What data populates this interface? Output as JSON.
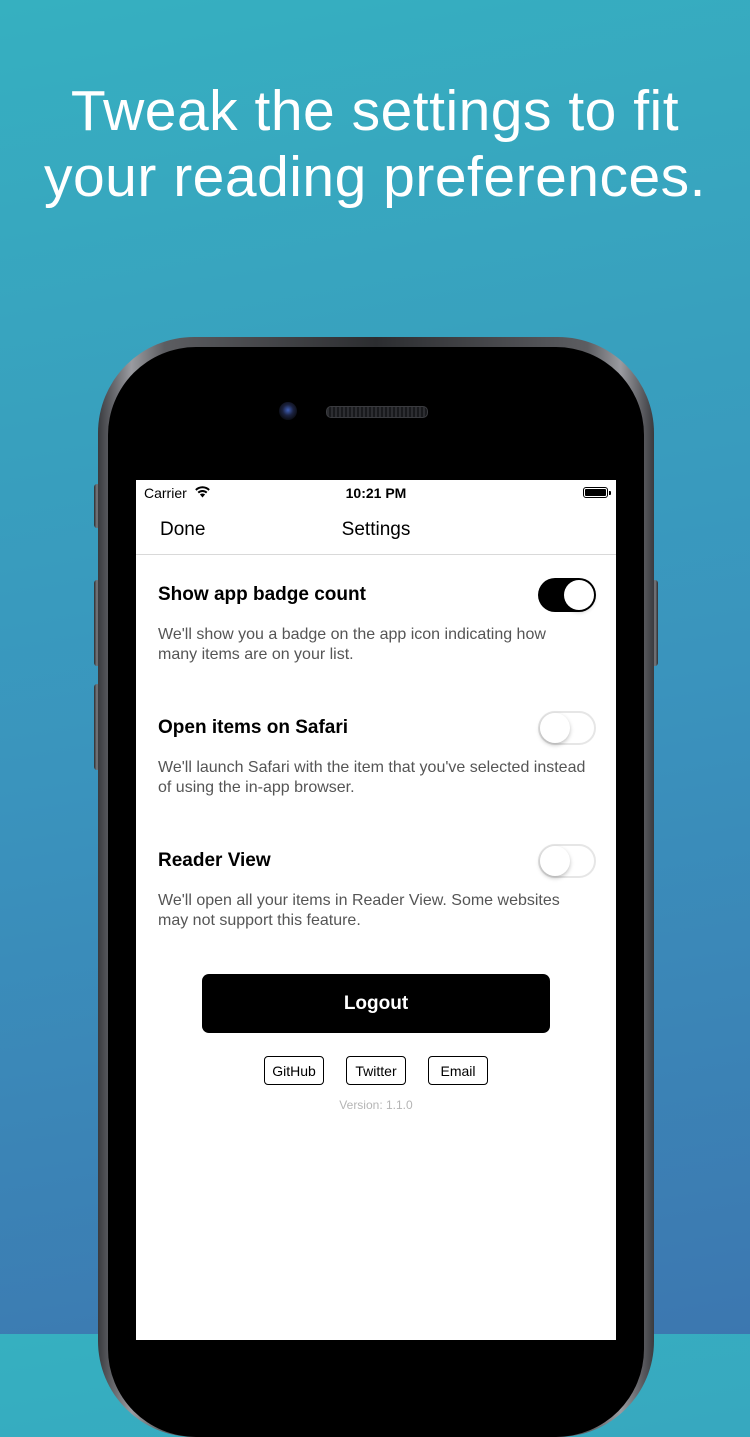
{
  "headline": {
    "line1": "Tweak the settings to fit",
    "line2": "your reading preferences."
  },
  "status_bar": {
    "carrier": "Carrier",
    "time": "10:21 PM"
  },
  "nav": {
    "done_label": "Done",
    "title": "Settings"
  },
  "settings": [
    {
      "title": "Show app badge count",
      "description": "We'll show you a badge on the app icon indicating how many items are on your list.",
      "enabled": true
    },
    {
      "title": "Open items on Safari",
      "description": "We'll launch Safari with the item that you've selected instead of using the in-app browser.",
      "enabled": false
    },
    {
      "title": "Reader View",
      "description": "We'll open all your items in Reader View. Some websites may not support this feature.",
      "enabled": false
    }
  ],
  "logout_label": "Logout",
  "links": {
    "github": "GitHub",
    "twitter": "Twitter",
    "email": "Email"
  },
  "version": "Version: 1.1.0",
  "colors": {
    "background_top": "#36b0c0",
    "background_bottom": "#3c77b0",
    "toggle_on": "#000000",
    "button_bg": "#000000"
  }
}
